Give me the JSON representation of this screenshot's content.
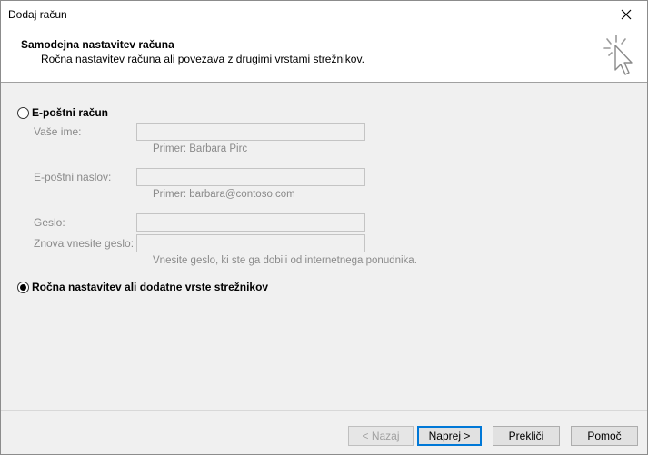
{
  "window": {
    "title": "Dodaj račun"
  },
  "header": {
    "title": "Samodejna nastavitev računa",
    "subtitle": "Ročna nastavitev računa ali povezava z drugimi vrstami strežnikov.",
    "icon": "cursor-click-icon"
  },
  "options": {
    "email_account": {
      "label": "E-poštni račun",
      "selected": false
    },
    "manual_setup": {
      "label": "Ročna nastavitev ali dodatne vrste strežnikov",
      "selected": true
    }
  },
  "fields": {
    "name": {
      "label": "Vaše ime:",
      "value": "",
      "hint": "Primer: Barbara Pirc"
    },
    "email": {
      "label": "E-poštni naslov:",
      "value": "",
      "hint": "Primer: barbara@contoso.com"
    },
    "password": {
      "label": "Geslo:",
      "value": ""
    },
    "password_confirm": {
      "label": "Znova vnesite geslo:",
      "value": "",
      "hint": "Vnesite geslo, ki ste ga dobili od internetnega ponudnika."
    }
  },
  "buttons": {
    "back": "< Nazaj",
    "next": "Naprej >",
    "cancel": "Prekliči",
    "help": "Pomoč"
  },
  "colors": {
    "accent": "#0078d7",
    "disabled_text": "#8a8a8a",
    "background": "#f0f0f0"
  }
}
